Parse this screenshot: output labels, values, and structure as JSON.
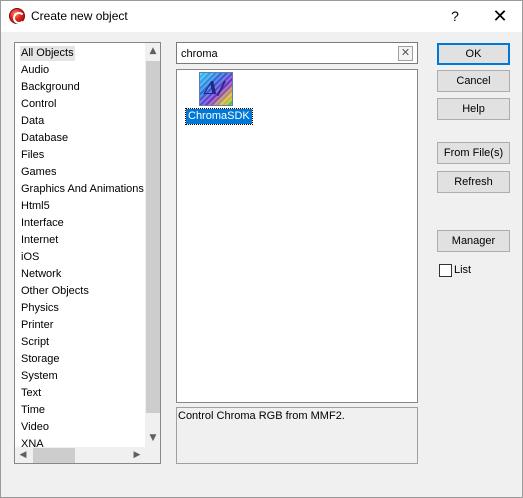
{
  "window": {
    "title": "Create new object",
    "help_glyph": "?",
    "close_glyph": "✕"
  },
  "categories": {
    "items": [
      "All Objects",
      "Audio",
      "Background",
      "Control",
      "Data",
      "Database",
      "Files",
      "Games",
      "Graphics And Animations",
      "Html5",
      "Interface",
      "Internet",
      "iOS",
      "Network",
      "Other Objects",
      "Physics",
      "Printer",
      "Script",
      "Storage",
      "System",
      "Text",
      "Time",
      "Video",
      "XNA"
    ],
    "selected": "All Objects"
  },
  "search": {
    "value": "chroma",
    "clear_glyph": "✕"
  },
  "objects": [
    {
      "label": "ChromaSDK",
      "icon": "chromasdk-icon",
      "selected": true
    }
  ],
  "description": "Control Chroma RGB from MMF2.",
  "buttons": {
    "ok": "OK",
    "cancel": "Cancel",
    "help": "Help",
    "from_files": "From File(s)",
    "refresh": "Refresh",
    "manager": "Manager"
  },
  "list_checkbox": {
    "label": "List",
    "checked": false
  },
  "colors": {
    "selection": "#0078d7",
    "dialog_bg": "#f0f0f0",
    "app_icon": "#e0261a"
  }
}
